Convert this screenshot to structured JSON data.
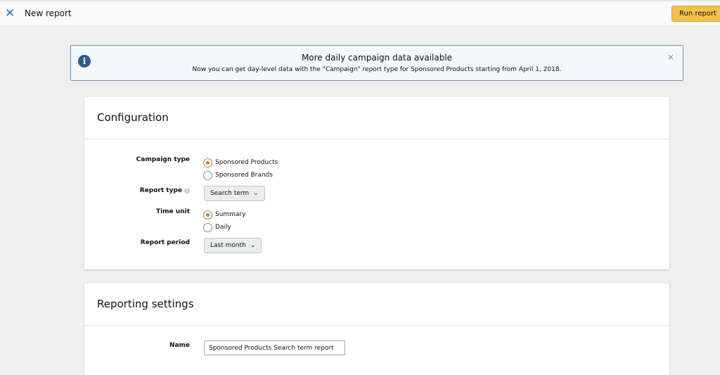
{
  "header": {
    "title": "New report",
    "run_label": "Run report"
  },
  "alert": {
    "title": "More daily campaign data available",
    "body": "Now you can get day-level data with the \"Campaign\" report type for Sponsored Products starting from April 1, 2018.",
    "close": "×"
  },
  "config": {
    "title": "Configuration",
    "campaign_type": {
      "label": "Campaign type",
      "options": [
        "Sponsored Products",
        "Sponsored Brands"
      ],
      "selected": 0
    },
    "report_type": {
      "label": "Report type",
      "value": "Search term"
    },
    "time_unit": {
      "label": "Time unit",
      "options": [
        "Summary",
        "Daily"
      ],
      "selected": 0
    },
    "report_period": {
      "label": "Report period",
      "value": "Last month"
    }
  },
  "settings": {
    "title": "Reporting settings",
    "name_label": "Name",
    "name_value": "Sponsored Products Search term report"
  }
}
